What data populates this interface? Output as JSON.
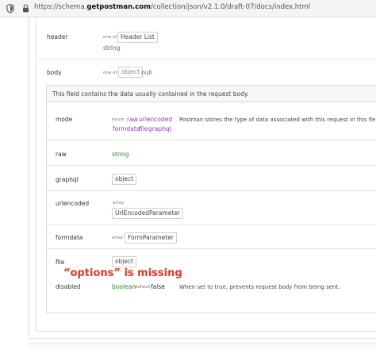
{
  "browser": {
    "url_prefix": "https://schema.",
    "url_domain": "getpostman.com",
    "url_suffix": "/collection/json/v2.1.0/draft-07/docs/index.html"
  },
  "fields": {
    "header": {
      "label": "header",
      "one_of": "one of",
      "ref": "Header List",
      "alt_type": "string"
    },
    "body": {
      "label": "body",
      "one_of": "one of",
      "type": "object",
      "alt_type": "null"
    }
  },
  "body_panel": {
    "description": "This field contains the data usually contained in the request body.",
    "rows": {
      "mode": {
        "label": "mode",
        "enum_label": "enum",
        "values_line1": [
          "raw",
          "urlencoded"
        ],
        "values_line2": [
          "formdata",
          "file",
          "graphql"
        ],
        "description": "Postman stores the type of data associated with this request in this field."
      },
      "raw": {
        "label": "raw",
        "type": "string"
      },
      "graphql": {
        "label": "graphql",
        "type": "object"
      },
      "urlencoded": {
        "label": "urlencoded",
        "array_label": "array",
        "ref": "UrlEncodedParameter"
      },
      "formdata": {
        "label": "formdata",
        "array_label": "array",
        "ref": "FormParameter"
      },
      "file": {
        "label": "file",
        "type": "object"
      },
      "disabled": {
        "label": "disabled",
        "type": "boolean",
        "default_label": "default",
        "default_value": "false",
        "description": "When set to true, prevents request body from being sent."
      }
    }
  },
  "annotation": {
    "text": "“options” is missing",
    "color": "#e0392b"
  }
}
